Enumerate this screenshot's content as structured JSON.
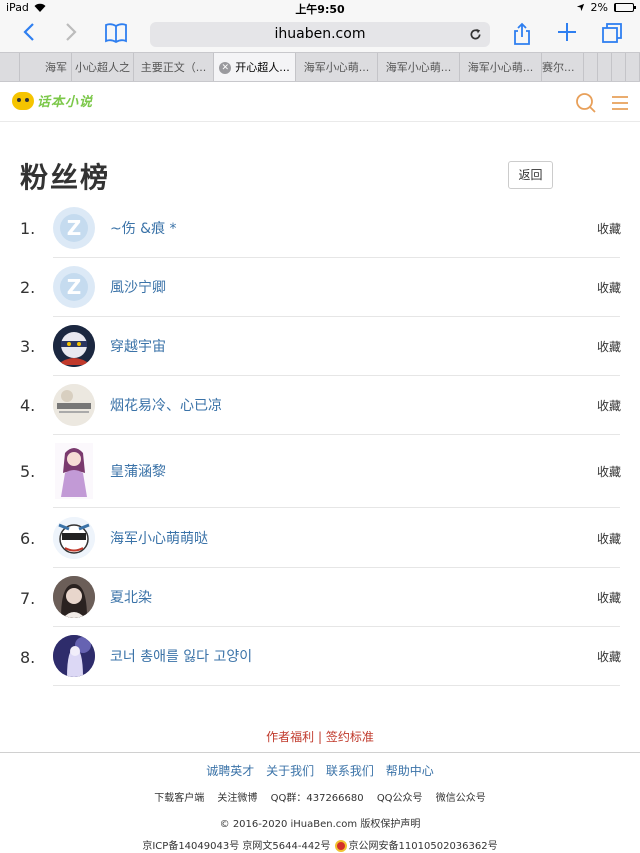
{
  "status_bar": {
    "device": "iPad",
    "time": "上午9:50",
    "battery": "2%"
  },
  "browser": {
    "url": "ihuaben.com",
    "tabs": [
      {
        "label": "海军"
      },
      {
        "label": "小心超人之"
      },
      {
        "label": "主要正文（..."
      },
      {
        "label": "开心超人...",
        "active": true
      },
      {
        "label": "海军小心萌..."
      },
      {
        "label": "海军小心萌..."
      },
      {
        "label": "海军小心萌..."
      },
      {
        "label": "赛尔..."
      }
    ]
  },
  "site": {
    "logo_text": "话本小说"
  },
  "page": {
    "title": "粉丝榜",
    "back_label": "返回"
  },
  "ranking": [
    {
      "rank": "1.",
      "name": "~伤 &痕 *",
      "action": "收藏",
      "avatar": "default",
      "avatar_color": "#dce9f6"
    },
    {
      "rank": "2.",
      "name": "風沙宁卿",
      "action": "收藏",
      "avatar": "default",
      "avatar_color": "#dce9f6"
    },
    {
      "rank": "3.",
      "name": "穿越宇宙",
      "action": "收藏",
      "avatar": "ninja",
      "avatar_color": "#1b2740"
    },
    {
      "rank": "4.",
      "name": "烟花易冷、心已凉",
      "action": "收藏",
      "avatar": "card",
      "avatar_color": "#e9e4dc"
    },
    {
      "rank": "5.",
      "name": "皇蒲涵黎",
      "action": "收藏",
      "avatar": "girl",
      "avatar_color": "#f2eef5"
    },
    {
      "rank": "6.",
      "name": "海军小心萌萌哒",
      "action": "收藏",
      "avatar": "hero",
      "avatar_color": "#e9f1fb"
    },
    {
      "rank": "7.",
      "name": "夏北染",
      "action": "收藏",
      "avatar": "photo",
      "avatar_color": "#5a4e4a"
    },
    {
      "rank": "8.",
      "name": "코너 총애를 잃다 고양이",
      "action": "收藏",
      "avatar": "purple",
      "avatar_color": "#3a3a7a"
    }
  ],
  "footer": {
    "author_benefit": "作者福利",
    "divider": "|",
    "sign_standard": "签约标准",
    "nav": [
      "诚聘英才",
      "关于我们",
      "联系我们",
      "帮助中心"
    ],
    "info": [
      "下载客户端",
      "关注微博",
      "QQ群：437266680",
      "QQ公众号",
      "微信公众号"
    ],
    "copyright": "© 2016-2020 iHuaBen.com 版权保护声明",
    "icp": "京ICP备14049043号 京网文5644-442号",
    "police": "京公网安备11010502036362号"
  },
  "colors": {
    "link": "#3b73a8",
    "accent": "#e8a05a",
    "footer_red": "#c0392b",
    "ios_blue": "#2f7ff0"
  }
}
